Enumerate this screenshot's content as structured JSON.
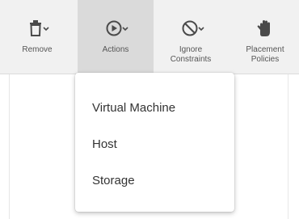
{
  "toolbar": {
    "buttons": [
      {
        "label": "Remove",
        "icon": "trash-icon"
      },
      {
        "label": "Actions",
        "icon": "play-circle-icon"
      },
      {
        "label": "Ignore\nConstraints",
        "icon": "prohibit-icon"
      },
      {
        "label": "Placement\nPolicies",
        "icon": "hand-icon"
      }
    ]
  },
  "actions_menu": {
    "items": [
      {
        "label": "Virtual Machine"
      },
      {
        "label": "Host"
      },
      {
        "label": "Storage"
      }
    ]
  },
  "colors": {
    "toolbar_bg": "#f1f1f1",
    "active_button_bg": "#dadada",
    "icon": "#4a4a4a",
    "menu_text": "#333333"
  }
}
